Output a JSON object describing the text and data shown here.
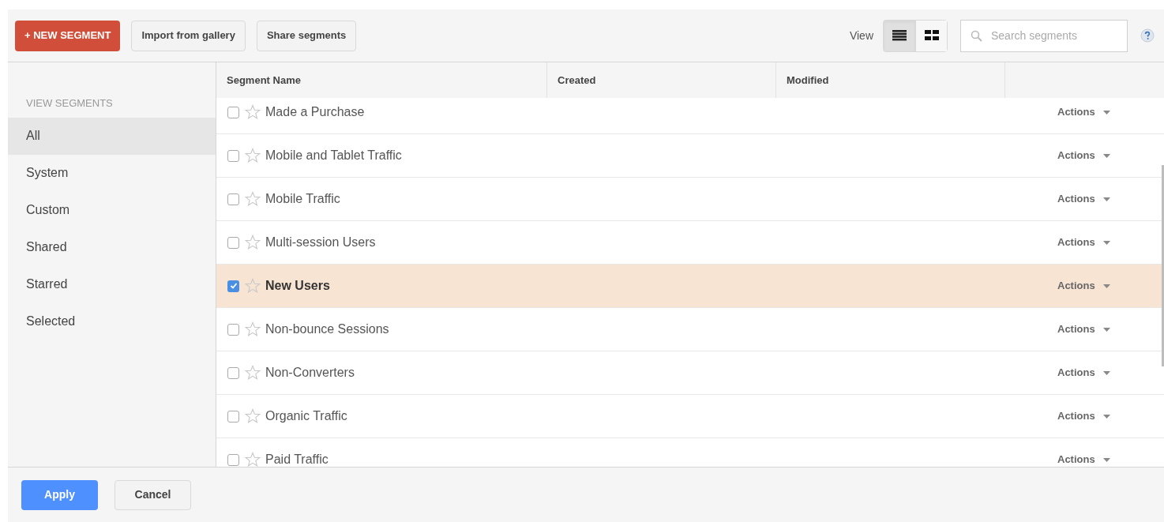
{
  "toolbar": {
    "new_button": "+ NEW SEGMENT",
    "buttons": [
      "Import from gallery",
      "Share segments"
    ],
    "view_label": "View",
    "view_modes": [
      {
        "kind": "list",
        "selected": true
      },
      {
        "kind": "grid",
        "selected": false
      }
    ],
    "search": {
      "placeholder": "Search segments"
    }
  },
  "sidebar": {
    "heading": "VIEW SEGMENTS",
    "items": [
      {
        "label": "All",
        "selected": true
      },
      {
        "label": "System",
        "selected": false
      },
      {
        "label": "Custom",
        "selected": false
      },
      {
        "label": "Shared",
        "selected": false
      },
      {
        "label": "Starred",
        "selected": false
      },
      {
        "label": "Selected",
        "selected": false
      }
    ]
  },
  "table": {
    "columns": [
      "Segment Name",
      "Created",
      "Modified"
    ],
    "rows": [
      {
        "name": "Made a Purchase",
        "checked": false,
        "action": "Actions"
      },
      {
        "name": "Mobile and Tablet Traffic",
        "checked": false,
        "action": "Actions"
      },
      {
        "name": "Mobile Traffic",
        "checked": false,
        "action": "Actions"
      },
      {
        "name": "Multi-session Users",
        "checked": false,
        "action": "Actions"
      },
      {
        "name": "New Users",
        "checked": true,
        "action": "Actions"
      },
      {
        "name": "Non-bounce Sessions",
        "checked": false,
        "action": "Actions"
      },
      {
        "name": "Non-Converters",
        "checked": false,
        "action": "Actions"
      },
      {
        "name": "Organic Traffic",
        "checked": false,
        "action": "Actions"
      },
      {
        "name": "Paid Traffic",
        "checked": false,
        "action": "Actions"
      }
    ]
  },
  "footer": {
    "apply": "Apply",
    "cancel": "Cancel"
  }
}
